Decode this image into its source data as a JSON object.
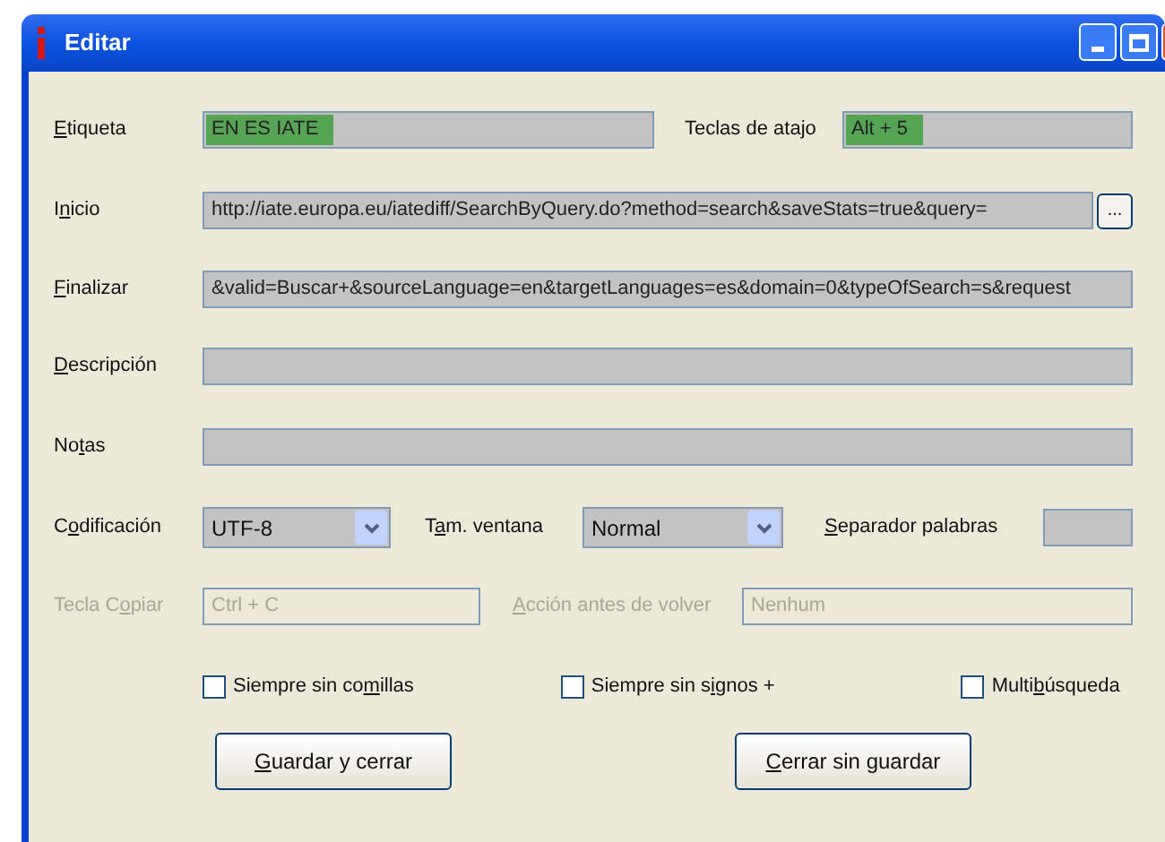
{
  "window": {
    "title": "Editar"
  },
  "etiqueta": {
    "label": {
      "key": "E",
      "post": "tiqueta"
    },
    "value": "EN ES IATE",
    "highlighted": true
  },
  "teclas_de_atajo": {
    "label": {
      "pre": "Teclas de atajo"
    },
    "value": "Alt + 5",
    "highlighted": true
  },
  "inicio": {
    "label": {
      "pre": "I",
      "key": "n",
      "post": "icio"
    },
    "value": "http://iate.europa.eu/iatediff/SearchByQuery.do?method=search&saveStats=true&query=",
    "browse_button": "..."
  },
  "finalizar": {
    "label": {
      "key": "F",
      "post": "inalizar"
    },
    "value": "&valid=Buscar+&sourceLanguage=en&targetLanguages=es&domain=0&typeOfSearch=s&request"
  },
  "descripcion": {
    "label": {
      "key": "D",
      "post": "escripción"
    }
  },
  "notas": {
    "label": {
      "pre": "No",
      "key": "t",
      "post": "as"
    }
  },
  "codificacion": {
    "label": {
      "pre": "C",
      "key": "o",
      "post": "dificación"
    },
    "value": "UTF-8"
  },
  "tam_ventana": {
    "label": {
      "pre": "T",
      "key": "a",
      "post": "m. ventana"
    },
    "value": "Normal"
  },
  "separador_palabras": {
    "label": {
      "key": "S",
      "post": "eparador palabras"
    }
  },
  "tecla_copiar": {
    "label": {
      "pre": "Tecla C",
      "key": "o",
      "post": "piar"
    },
    "value": "Ctrl + C",
    "disabled": true
  },
  "accion_antes_de_volver": {
    "label": {
      "key": "A",
      "post": "cción antes de volver"
    },
    "value": "Nenhum",
    "disabled": true
  },
  "checkboxes": [
    {
      "label": {
        "pre": "Siempre sin co",
        "key": "m",
        "post": "illas"
      },
      "checked": false
    },
    {
      "label": {
        "pre": "Siempre sin s",
        "key": "i",
        "post": "gnos +"
      },
      "checked": false
    },
    {
      "label": {
        "pre": "Multi",
        "key": "b",
        "post": "úsqueda"
      },
      "checked": false
    }
  ],
  "buttons": [
    {
      "label": {
        "key": "G",
        "post": "uardar y cerrar"
      }
    },
    {
      "label": {
        "key": "C",
        "post": "errar sin guardar"
      }
    }
  ]
}
